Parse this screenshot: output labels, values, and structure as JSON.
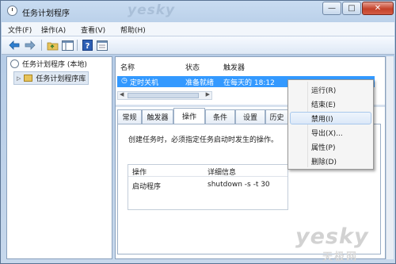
{
  "window": {
    "title": "任务计划程序",
    "watermark": "yesky",
    "controls": {
      "minimize": "—",
      "maximize": "□",
      "close": "✕"
    }
  },
  "menubar": {
    "items": [
      "文件(F)",
      "操作(A)",
      "查看(V)",
      "帮助(H)"
    ]
  },
  "toolbar": {
    "icons": [
      "back-arrow-icon",
      "forward-arrow-icon",
      "folder-up-icon",
      "show-hide-tree-icon",
      "help-icon",
      "properties-icon"
    ]
  },
  "tree": {
    "root": "任务计划程序 (本地)",
    "child": "任务计划程序库"
  },
  "task_list": {
    "columns": [
      "名称",
      "状态",
      "触发器"
    ],
    "rows": [
      {
        "name": "定时关机",
        "status": "准备就绪",
        "trigger": "在每天的 18:12"
      }
    ]
  },
  "tabs": [
    "常规",
    "触发器",
    "操作",
    "条件",
    "设置",
    "历史"
  ],
  "active_tab": "操作",
  "details": {
    "description": "创建任务时，必须指定任务启动时发生的操作。",
    "columns": [
      "操作",
      "详细信息"
    ],
    "rows": [
      {
        "action": "启动程序",
        "detail": "shutdown -s -t 30"
      }
    ]
  },
  "context_menu": {
    "items": [
      "运行(R)",
      "结束(E)",
      "禁用(I)",
      "导出(X)...",
      "属性(P)",
      "删除(D)"
    ],
    "highlighted": "禁用(I)"
  },
  "brand": {
    "logo_text": "yesky",
    "logo_sub": "天极网"
  },
  "colors": {
    "selection": "#3399ff",
    "window_frame": "#b4cbe6"
  }
}
